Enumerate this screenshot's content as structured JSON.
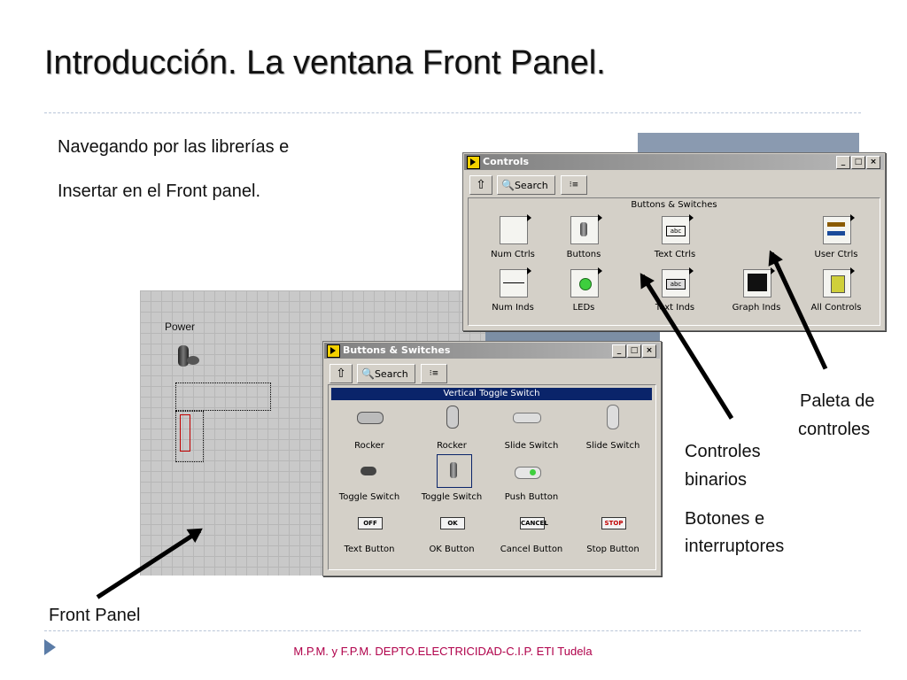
{
  "slide": {
    "title": "Introducción. La ventana Front Panel.",
    "intro_line1": "Navegando por las librerías e",
    "intro_line2": "Insertar en el Front panel.",
    "callout_palette_line1": "Paleta de",
    "callout_palette_line2": "controles",
    "callout_binary_line1": "Controles",
    "callout_binary_line2": "binarios",
    "callout_buttons_line1": "Botones e",
    "callout_buttons_line2": "interruptores",
    "callout_front_panel": "Front Panel",
    "footer": "M.P.M. y F.P.M. DEPTO.ELECTRICIDAD-C.I.P. ETI Tudela"
  },
  "front_panel": {
    "power_label": "Power"
  },
  "controls_window": {
    "title": "Controls",
    "search_label": "Search",
    "palette_heading": "Buttons & Switches",
    "items": [
      {
        "label": "Num Ctrls",
        "icon": "num-ctrls-icon"
      },
      {
        "label": "Buttons",
        "icon": "buttons-icon"
      },
      {
        "label": "Text Ctrls",
        "icon": "text-ctrls-icon"
      },
      {
        "label": "User Ctrls",
        "icon": "user-ctrls-icon"
      },
      {
        "label": "Num Inds",
        "icon": "num-inds-icon"
      },
      {
        "label": "LEDs",
        "icon": "leds-icon"
      },
      {
        "label": "Text Inds",
        "icon": "text-inds-icon"
      },
      {
        "label": "Graph Inds",
        "icon": "graph-inds-icon"
      },
      {
        "label": "All Controls",
        "icon": "all-controls-icon"
      }
    ]
  },
  "buttons_window": {
    "title": "Buttons & Switches",
    "search_label": "Search",
    "selected_item": "Vertical Toggle Switch",
    "items": [
      {
        "label": "Rocker"
      },
      {
        "label": "Rocker"
      },
      {
        "label": "Slide Switch"
      },
      {
        "label": "Slide Switch"
      },
      {
        "label": "Toggle Switch"
      },
      {
        "label": "Toggle Switch"
      },
      {
        "label": "Push Button"
      },
      {
        "label": "Text Button",
        "face": "OFF"
      },
      {
        "label": "OK Button",
        "face": "OK"
      },
      {
        "label": "Cancel Button",
        "face": "CANCEL"
      },
      {
        "label": "Stop Button",
        "face": "STOP"
      }
    ]
  },
  "colors": {
    "footer": "#b0004a",
    "bullet": "#5b7ca7",
    "selection": "#0a246a",
    "led": "#3ecf3e"
  }
}
